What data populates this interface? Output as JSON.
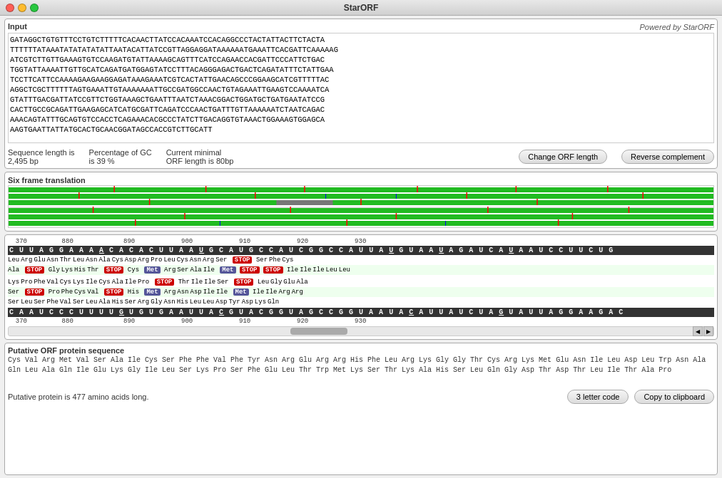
{
  "titleBar": {
    "title": "StarORF"
  },
  "input": {
    "label": "Input",
    "poweredBy": "Powered by StarORF",
    "sequence": "GATAGGCTGTGTTTCCTGTCTTTTTCACAACTTATCCACAAATCCACAGGCCCTACTATTACTTCTACTA\n        TTTTTTATAAATATATATATATTAATACATTATCCGTTAGGAGGATAAAAAATGAAATTCACGATTCAAAAAG\n        ATCGTCTTGTTGAAAGTGTCCAAGATGTATTAAAAGCAGTTTCATCCAGAACCACGATTCCCATTCTGAC\n        TGGTATTAAAATTGTTGCATCAGATGATGGAGTATCCTTTACAGGGAGACTGACTCAGATATTTCTATTGAA\n        TCCTTCATTCCAAAAGAAGAAGGAGATAAAGAAATCGTCACTATTGAACAGCCCGGAAGCATCGTTTTTAC\n        AGGCTCGCTTTTTTAGTGAAATTGTAAAAAAATTGCCGATGGCCAACTGTAGAAATTGAAGTCCAAAATCA\n        GTATTTGACGATTATCCGTTCTGGTAAAGCTGAATTTAATCTAAACGGACTGGATGCTGATGAATATCCG\n        CACTTGCCGCAGATTGAAGAGCATCATGCGATTCAGATCCCAACTGATTTGTTAAAAAATCTAATCAGAC\n        AAACAGTATTTGCAGTGTCCACCTCAGAAACACGCCCTATCTTGACAGGTGTAAACTGGAAAGTGGAGCA\n        AAGTGAATTATTATGCACTGCAACGGATAGCCACCGTCTTGCATT"
  },
  "stats": {
    "sequenceLength": "Sequence length is\n2,495 bp",
    "gcContent": "Percentage of GC\nis 39 %",
    "orfLength": "Current minimal\nORF length is 80bp",
    "changeOrfBtn": "Change ORF length",
    "revCompBtn": "Reverse complement"
  },
  "sixFrame": {
    "label": "Six frame translation"
  },
  "sequenceViewer": {
    "coords": "370          880               890              900              910              920              930",
    "topSeq": "C U U A G G A A A A C A C A C U U A A U G C A U G C C A U C G G C C A U U A U G U A A U A G A U C A U A A U C C U U C U G",
    "bottomSeq": "C A A U C C C U U U U G U G U G A A U U A C G U A C G G U A G C C G G U A A U A C A U U A U C U A G U A U U A G G A A G A C"
  },
  "protein": {
    "label": "Putative ORF protein sequence",
    "sequence": "Cys Val Arg Met Val Ser Ala Ile Cys Ser Phe Phe Val Phe Tyr Asn Arg Glu Arg Arg His Phe Leu Arg Lys Gly Gly Thr Cys Arg Lys Met Glu Asn Ile Leu Asp Leu Trp Asn Ala Gln Leu Ala Gln Ile Glu Lys Gly Ile Leu Ser Lys Pro Ser Phe Glu Leu Thr Trp Met Lys Ser Thr Lys Ala His Ser Leu Gln Gly Asp Thr Asp Thr Leu Ile Thr Ala Pro",
    "length": "Putative protein is 477 amino acids long.",
    "threeLetterBtn": "3 letter code",
    "clipboardBtn": "Copy to clipboard"
  },
  "colors": {
    "stopCodon": "#cc0000",
    "metCodon": "#555599",
    "greenBar": "#22bb22",
    "background": "#f0f0f0"
  }
}
